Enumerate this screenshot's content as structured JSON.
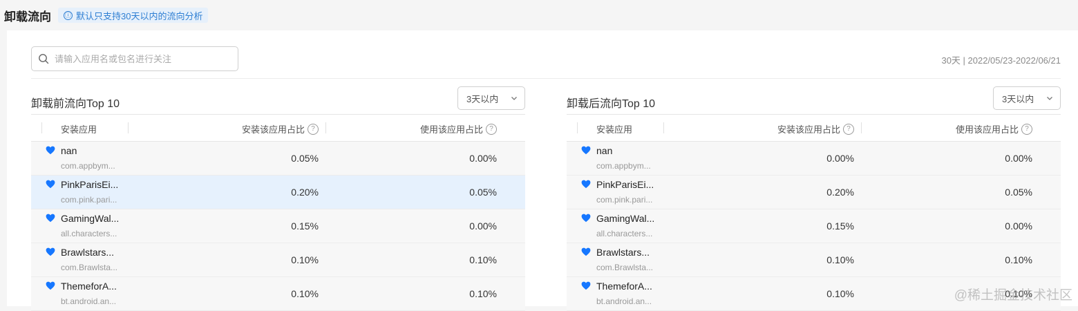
{
  "header": {
    "title": "卸载流向",
    "notice_icon": "ⓘ",
    "notice": "默认只支持30天以内的流向分析"
  },
  "search": {
    "placeholder": "请输入应用名或包名进行关注"
  },
  "date_range": "30天 | 2022/05/23-2022/06/21",
  "columns": {
    "app": "安装应用",
    "install_ratio": "安装该应用占比",
    "use_ratio": "使用该应用占比"
  },
  "help_glyph": "?",
  "panels": {
    "before": {
      "title": "卸载前流向Top 10",
      "filter": "3天以内",
      "rows": [
        {
          "name": "nan",
          "pkg": "com.appbym...",
          "install": "0.05%",
          "use": "0.00%"
        },
        {
          "name": "PinkParisEi...",
          "pkg": "com.pink.pari...",
          "install": "0.20%",
          "use": "0.05%"
        },
        {
          "name": "GamingWal...",
          "pkg": "all.characters...",
          "install": "0.15%",
          "use": "0.00%"
        },
        {
          "name": "Brawlstars...",
          "pkg": "com.Brawlsta...",
          "install": "0.10%",
          "use": "0.10%"
        },
        {
          "name": "ThemeforA...",
          "pkg": "bt.android.an...",
          "install": "0.10%",
          "use": "0.10%"
        }
      ]
    },
    "after": {
      "title": "卸载后流向Top 10",
      "filter": "3天以内",
      "rows": [
        {
          "name": "nan",
          "pkg": "com.appbym...",
          "install": "0.00%",
          "use": "0.00%"
        },
        {
          "name": "PinkParisEi...",
          "pkg": "com.pink.pari...",
          "install": "0.20%",
          "use": "0.05%"
        },
        {
          "name": "GamingWal...",
          "pkg": "all.characters...",
          "install": "0.15%",
          "use": "0.00%"
        },
        {
          "name": "Brawlstars...",
          "pkg": "com.Brawlsta...",
          "install": "0.10%",
          "use": "0.10%"
        },
        {
          "name": "ThemeforA...",
          "pkg": "bt.android.an...",
          "install": "0.10%",
          "use": "0.10%"
        }
      ]
    }
  },
  "watermark": "@稀土掘金技术社区",
  "colors": {
    "accent": "#2f7fd3",
    "heart": "#1677ff",
    "highlight_row": "#e6f1fd"
  }
}
